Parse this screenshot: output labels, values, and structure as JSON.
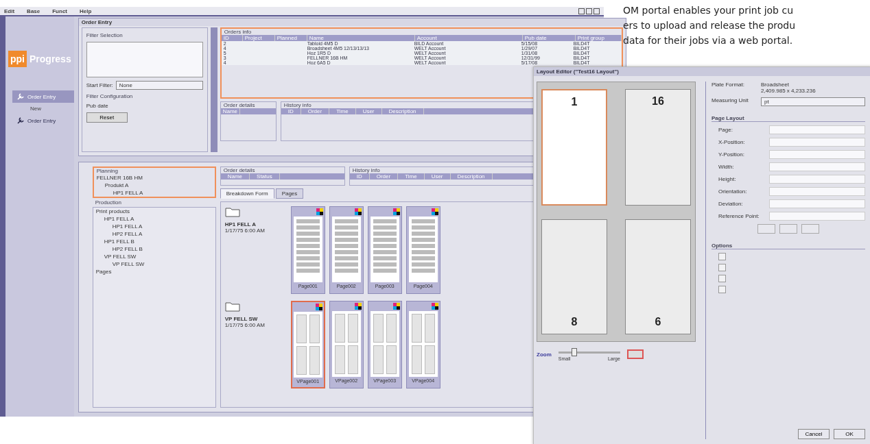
{
  "menu": [
    "Edit",
    "Base",
    "Funct",
    "Help"
  ],
  "logo": {
    "mark": "ppi",
    "name": "Progress"
  },
  "sidebar": {
    "items": [
      {
        "label": "Order Entry",
        "selected": true,
        "children": [
          {
            "label": "New"
          }
        ]
      },
      {
        "label": "Order Entry",
        "selected": false
      }
    ]
  },
  "order_entry": {
    "title": "Order Entry",
    "filter": {
      "section": "Filter Selection",
      "start_label": "Start Filter:",
      "start_value": "None",
      "config": "Filter Configuration",
      "pub_date": "Pub date",
      "reset": "Reset"
    },
    "orders": {
      "title": "Orders info",
      "columns": [
        "ID",
        "Project",
        "Planned",
        "Name",
        "Account",
        "Pub date",
        "Print group"
      ],
      "rows": [
        [
          "2",
          "",
          "",
          "Tabloid 4M5 D",
          "BILD Account",
          "5/15/08",
          "BILD4T"
        ],
        [
          "4",
          "",
          "",
          "Broadsheet 4M5 12/13/13/13",
          "WELT Account",
          "1/29/07",
          "BILD4T"
        ],
        [
          "5",
          "",
          "",
          "Hoz 1R5 D",
          "WELT Account",
          "1/31/08",
          "BILD4T"
        ],
        [
          "3",
          "",
          "",
          "FELLNER 16B HM",
          "WELT Account",
          "12/31/99",
          "BILD4T"
        ],
        [
          "4",
          "",
          "",
          "Hoz 6A5 D",
          "WELT Account",
          "5/17/08",
          "BILD4T"
        ]
      ]
    },
    "details": {
      "title": "Order details",
      "columns": [
        "Name"
      ]
    },
    "history": {
      "title": "History info",
      "columns": [
        "ID",
        "Order",
        "Time",
        "User",
        "Description"
      ]
    }
  },
  "production": {
    "planning": {
      "title": "Planning",
      "tree": [
        {
          "label": "FELLNER 16B HM",
          "children": [
            {
              "label": "Produkt A",
              "children": [
                {
                  "label": "HP1 FELL A"
                }
              ]
            }
          ]
        }
      ]
    },
    "production_tree": {
      "title": "Production",
      "tree": [
        {
          "label": "Print products",
          "children": [
            {
              "label": "HP1 FELL A",
              "children": [
                {
                  "label": "HP1 FELL A"
                },
                {
                  "label": "HP2 FELL A"
                }
              ]
            },
            {
              "label": "HP1 FELL B",
              "children": [
                {
                  "label": "HP2 FELL B"
                }
              ]
            },
            {
              "label": "VP FELL SW",
              "children": [
                {
                  "label": "VP FELL SW"
                }
              ]
            }
          ]
        },
        {
          "label": "Pages"
        }
      ]
    },
    "details": {
      "title": "Order details",
      "columns": [
        "Name",
        "Status"
      ]
    },
    "history": {
      "title": "History info",
      "columns": [
        "ID",
        "Order",
        "Time",
        "User",
        "Description"
      ]
    },
    "tabs": [
      {
        "label": "Breakdown Form",
        "selected": true
      },
      {
        "label": "Pages",
        "selected": false
      }
    ],
    "groups": [
      {
        "name": "HP1 FELL A",
        "date": "1/17/75 6:00 AM",
        "kind": "single",
        "pages": [
          {
            "label": "Page001",
            "selected": false
          },
          {
            "label": "Page002",
            "selected": false
          },
          {
            "label": "Page003",
            "selected": false
          },
          {
            "label": "Page004",
            "selected": false
          }
        ]
      },
      {
        "name": "VP FELL SW",
        "date": "1/17/75 6:00 AM",
        "kind": "quad",
        "pages": [
          {
            "label": "VPage001",
            "selected": true
          },
          {
            "label": "VPage002",
            "selected": false
          },
          {
            "label": "VPage003",
            "selected": false
          },
          {
            "label": "VPage004",
            "selected": false
          }
        ]
      }
    ]
  },
  "dialog": {
    "title": "Layout Editor (\"Test16 Layout\")",
    "pages": [
      {
        "number": "1",
        "selected": true
      },
      {
        "number": "16",
        "selected": false
      },
      {
        "number": "8",
        "selected": false
      },
      {
        "number": "6",
        "selected": false
      }
    ],
    "zoom": {
      "label": "Zoom",
      "min": "Small",
      "max": "Large",
      "level": 0.25
    },
    "plate_label": "Plate Format:",
    "plate_value": [
      "Broadsheet",
      "2,409.985 x 4,233.236"
    ],
    "unit_label": "Measuring Unit",
    "unit_value": "pt",
    "layout_section": "Page Layout",
    "fields": [
      "Page:",
      "X-Position:",
      "Y-Position:",
      "Width:",
      "Height:",
      "Orientation:",
      "Deviation:",
      "Reference Point:"
    ],
    "options_section": "Options",
    "options": [
      {
        "checked": false
      },
      {
        "checked": false
      },
      {
        "checked": false
      },
      {
        "checked": false
      }
    ],
    "buttons": [
      "Cancel",
      "OK"
    ]
  },
  "caption": [
    "OM portal enables your print job cu",
    "ers to upload and release the produ",
    "data for their jobs via a web portal."
  ]
}
